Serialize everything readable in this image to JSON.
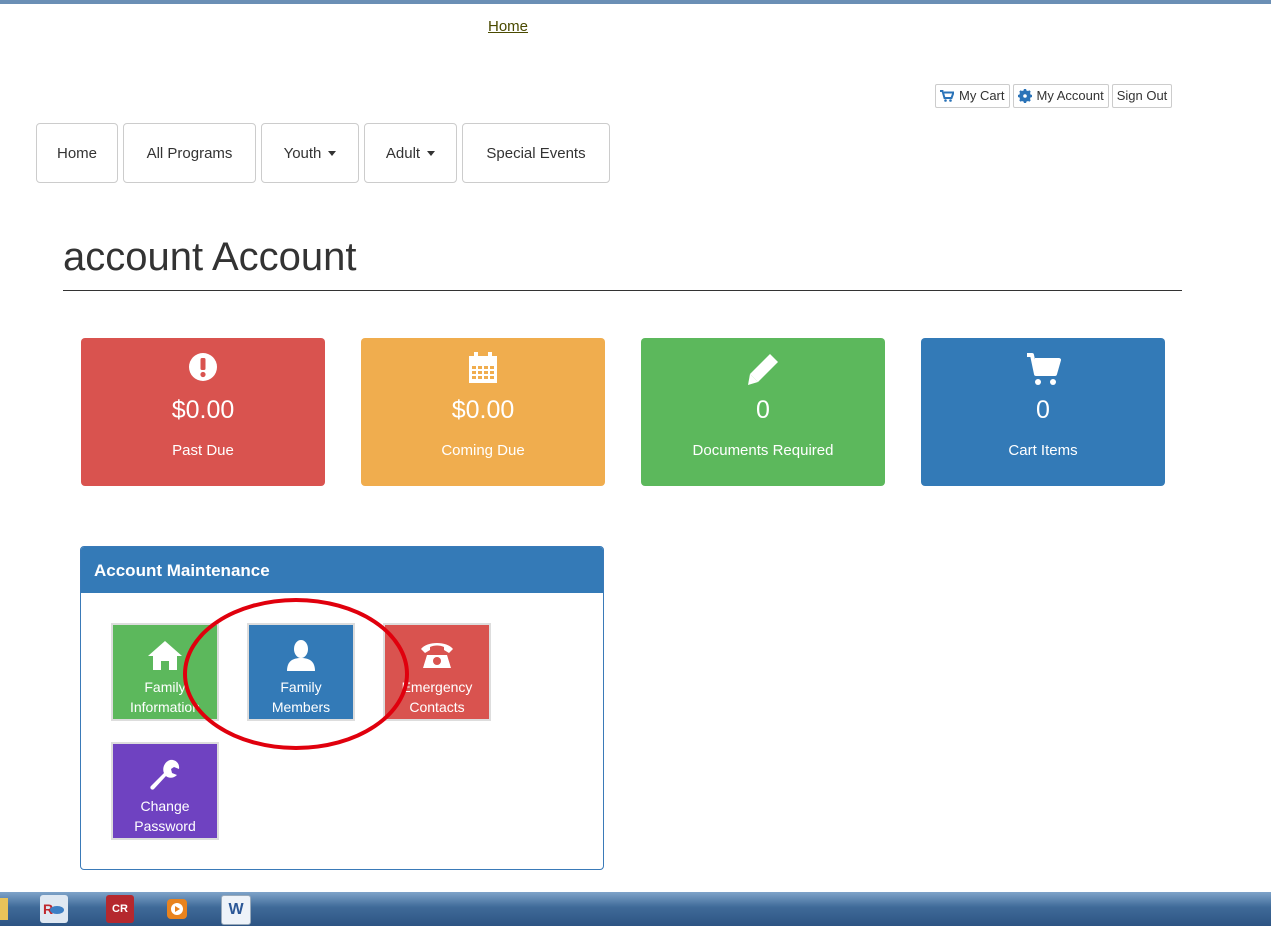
{
  "top": {
    "home_link": "Home"
  },
  "account_buttons": {
    "cart": "My Cart",
    "account": "My Account",
    "signout": "Sign Out"
  },
  "nav": {
    "home": "Home",
    "all_programs": "All Programs",
    "youth": "Youth",
    "adult": "Adult",
    "special_events": "Special Events"
  },
  "page": {
    "title": "account Account"
  },
  "stats": [
    {
      "value": "$0.00",
      "label": "Past Due",
      "color": "#d9534f",
      "icon": "exclamation-icon"
    },
    {
      "value": "$0.00",
      "label": "Coming Due",
      "color": "#f0ad4e",
      "icon": "calendar-icon"
    },
    {
      "value": "0",
      "label": "Documents Required",
      "color": "#5cb85c",
      "icon": "pencil-icon"
    },
    {
      "value": "0",
      "label": "Cart Items",
      "color": "#337ab7",
      "icon": "cart-icon"
    }
  ],
  "maintenance": {
    "heading": "Account Maintenance",
    "tiles": [
      {
        "line1": "Family",
        "line2": "Information",
        "color": "#5cb85c",
        "icon": "home-icon"
      },
      {
        "line1": "Family",
        "line2": "Members",
        "color": "#337ab7",
        "icon": "user-icon"
      },
      {
        "line1": "Emergency",
        "line2": "Contacts",
        "color": "#d9534f",
        "icon": "phone-icon"
      },
      {
        "line1": "Change",
        "line2": "Password",
        "color": "#6f42c1",
        "icon": "wrench-icon"
      }
    ]
  },
  "taskbar": {
    "app2": "CR",
    "app4": "W"
  }
}
